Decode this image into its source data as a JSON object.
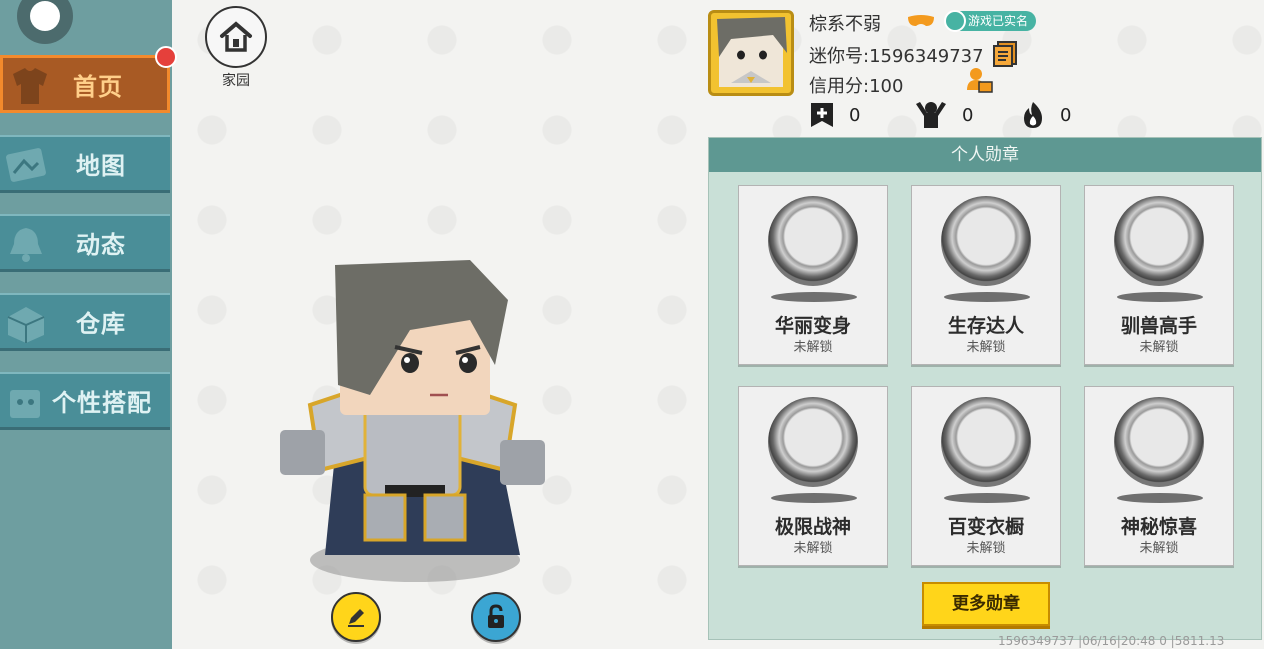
{
  "sidebar": {
    "items": [
      {
        "label": "首页",
        "active": true,
        "icon": "shirt-icon"
      },
      {
        "label": "地图",
        "active": false,
        "icon": "map-icon"
      },
      {
        "label": "动态",
        "active": false,
        "icon": "bell-icon"
      },
      {
        "label": "仓库",
        "active": false,
        "icon": "box-icon"
      },
      {
        "label": "个性搭配",
        "active": false,
        "icon": "outfit-icon"
      }
    ]
  },
  "home": {
    "label": "家园"
  },
  "profile": {
    "name": "棕系不弱",
    "verify_label": "游戏已实名",
    "mini_id": "迷你号:1596349737",
    "credit": "信用分:100",
    "stats": [
      {
        "icon": "bookmark-plus-icon",
        "value": "0"
      },
      {
        "icon": "fans-icon",
        "value": "0"
      },
      {
        "icon": "fire-icon",
        "value": "0"
      }
    ]
  },
  "badges": {
    "title": "个人勋章",
    "items": [
      {
        "name": "华丽变身",
        "state": "未解锁",
        "icon": "transform-medal-icon"
      },
      {
        "name": "生存达人",
        "state": "未解锁",
        "icon": "campfire-medal-icon"
      },
      {
        "name": "驯兽高手",
        "state": "未解锁",
        "icon": "rider-medal-icon"
      },
      {
        "name": "极限战神",
        "state": "未解锁",
        "icon": "boss-medal-icon"
      },
      {
        "name": "百变衣橱",
        "state": "未解锁",
        "icon": "wardrobe-medal-icon"
      },
      {
        "name": "神秘惊喜",
        "state": "未解锁",
        "icon": "gift-medal-icon"
      }
    ],
    "more_label": "更多勋章"
  },
  "footer": {
    "text": "1596349737   |06/16|20:48 0 |5811.13"
  },
  "colors": {
    "sidebar_bg": "#6e9ea0",
    "nav_bg": "#4a8e98",
    "nav_active_bg": "#a85a24",
    "nav_active_border": "#f38a2c",
    "badge_panel": "#c9e0d7",
    "badge_header": "#5e9892",
    "more_button": "#ffd51a",
    "verify_badge": "#47b3a3"
  }
}
